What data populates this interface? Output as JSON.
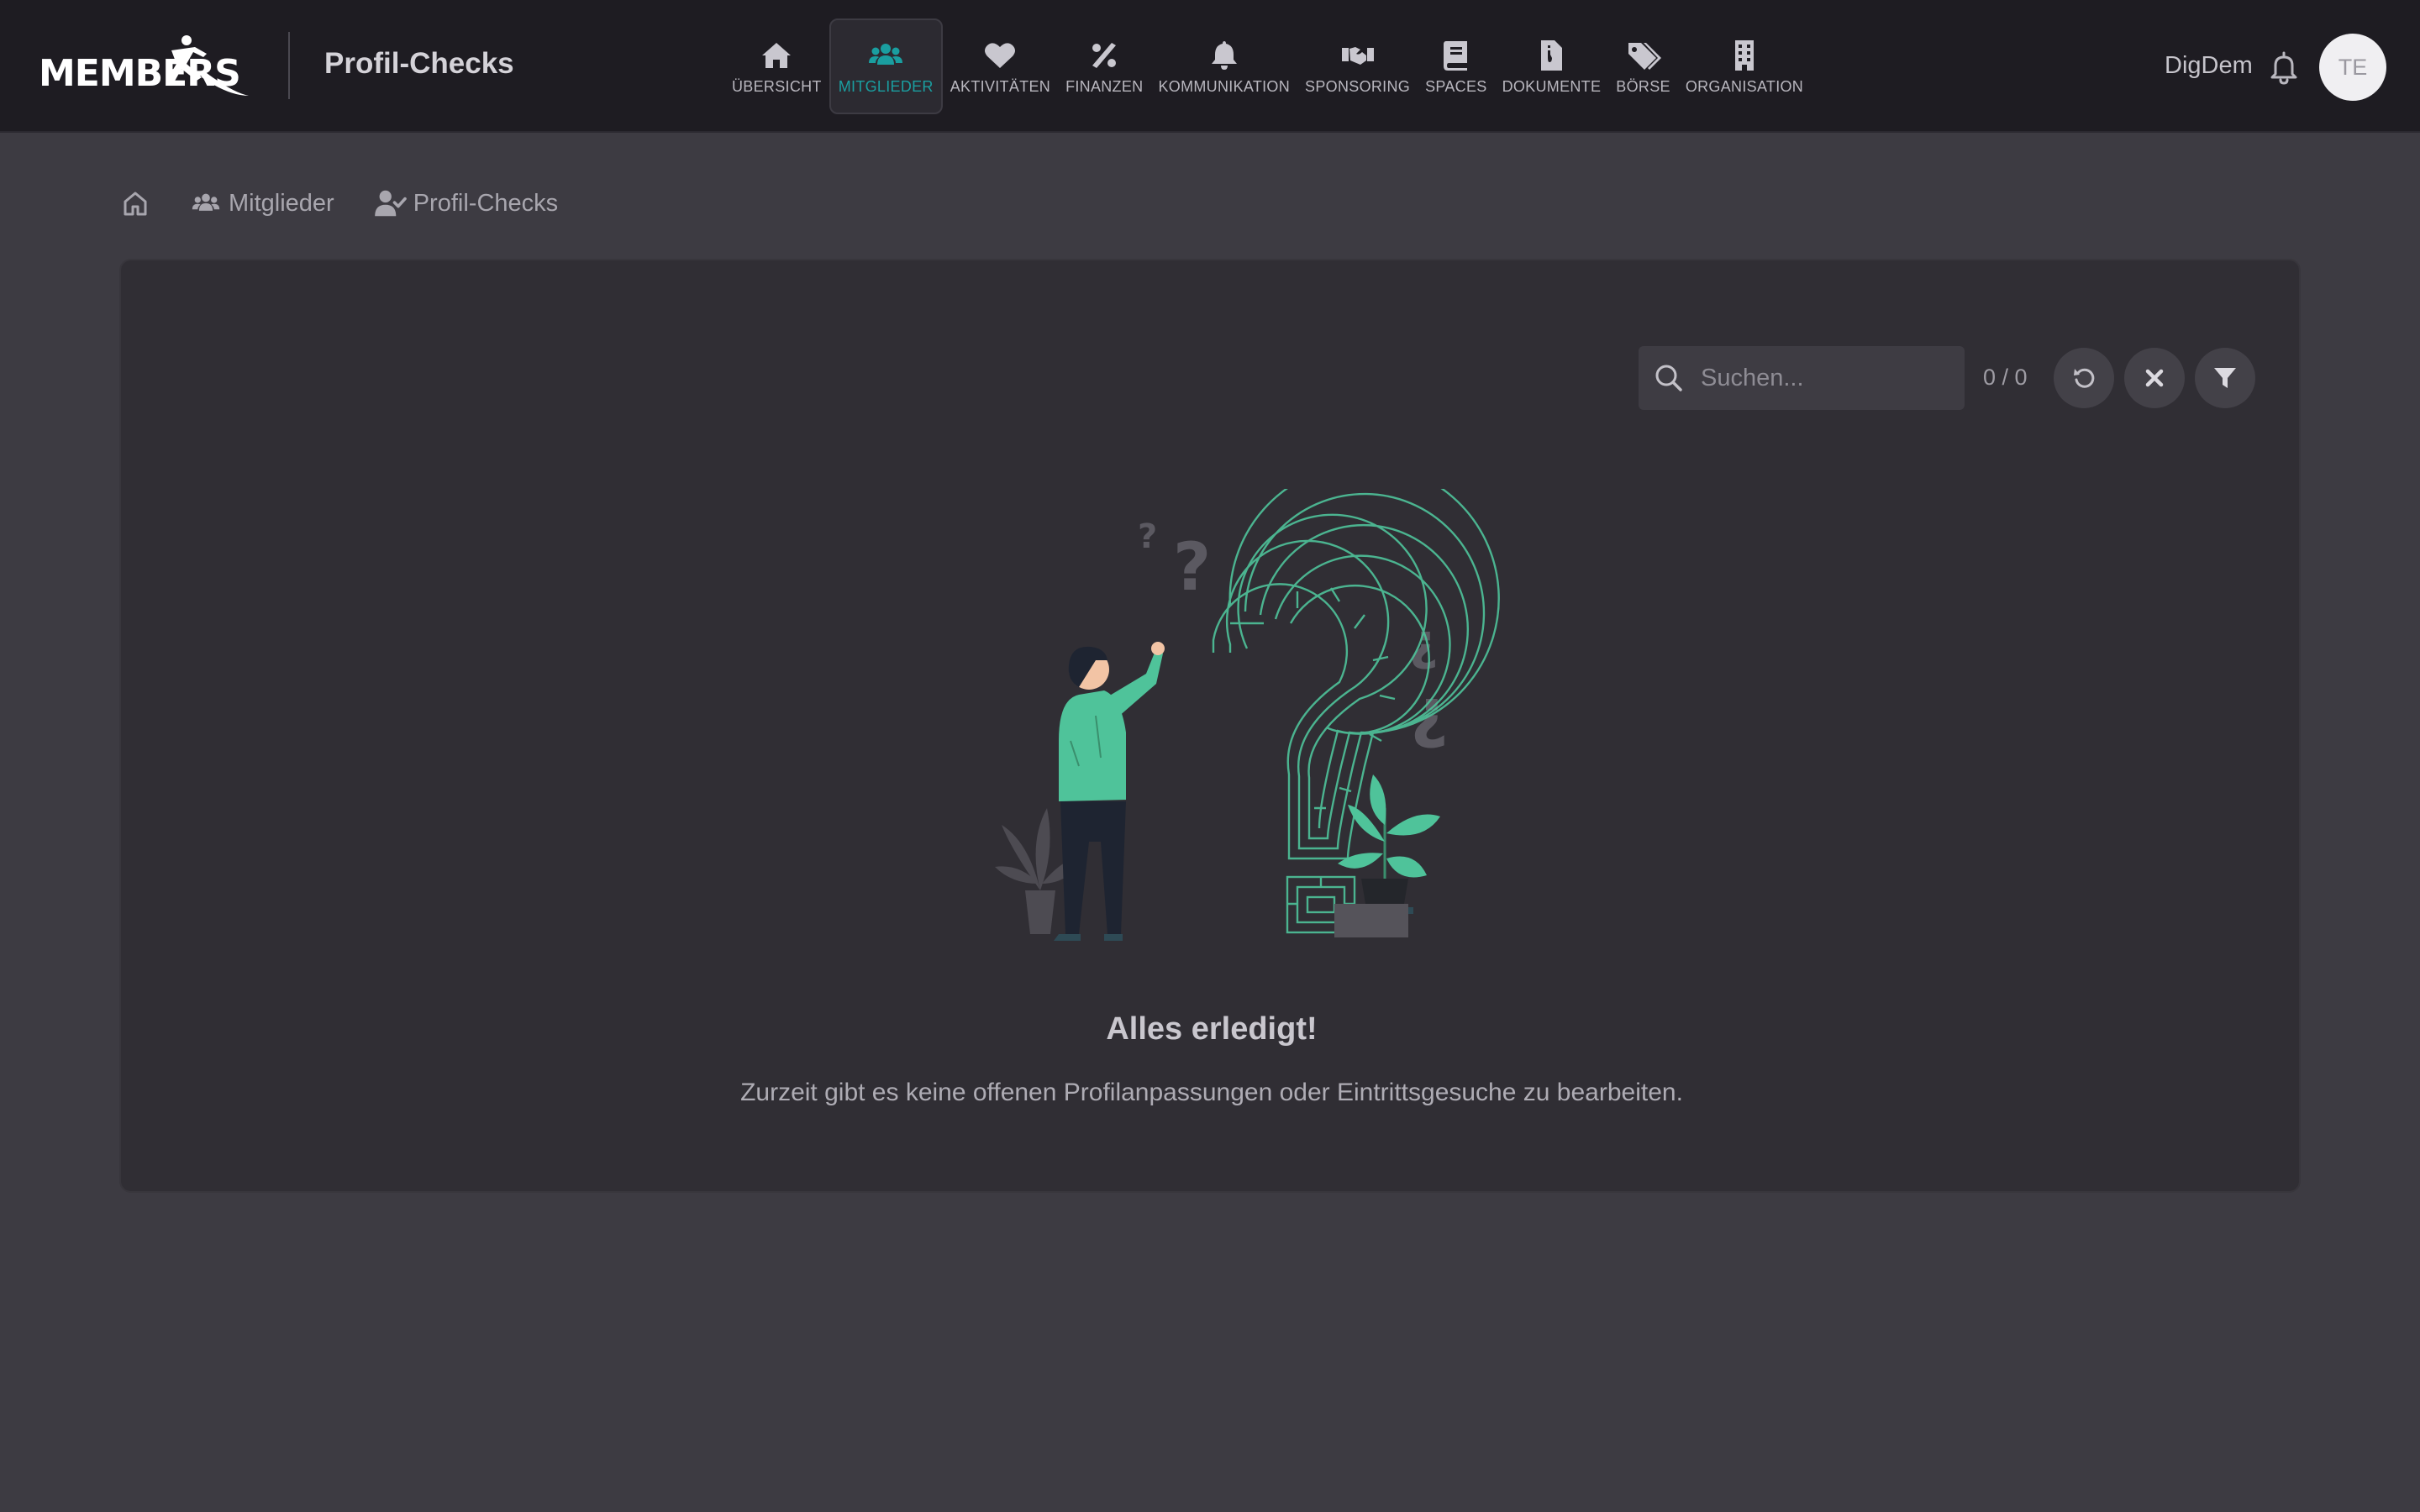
{
  "app": {
    "brand": "MEMBERS",
    "page_title": "Profil-Checks"
  },
  "nav": {
    "items": [
      {
        "label": "ÜBERSICHT",
        "icon": "home-icon"
      },
      {
        "label": "MITGLIEDER",
        "icon": "users-icon",
        "active": true
      },
      {
        "label": "AKTIVITÄTEN",
        "icon": "heart-pulse-icon"
      },
      {
        "label": "FINANZEN",
        "icon": "percent-icon"
      },
      {
        "label": "KOMMUNIKATION",
        "icon": "bell-icon"
      },
      {
        "label": "SPONSORING",
        "icon": "handshake-icon"
      },
      {
        "label": "SPACES",
        "icon": "book-icon"
      },
      {
        "label": "DOKUMENTE",
        "icon": "file-zipper-icon"
      },
      {
        "label": "BÖRSE",
        "icon": "tags-icon"
      },
      {
        "label": "ORGANISATION",
        "icon": "building-icon"
      }
    ],
    "active_color": "#1a9ea0"
  },
  "user": {
    "name": "DigDem",
    "initials": "TE"
  },
  "breadcrumb": {
    "items": [
      {
        "label": "",
        "icon": "home-icon"
      },
      {
        "label": "Mitglieder",
        "icon": "users-icon"
      },
      {
        "label": "Profil-Checks",
        "icon": "user-check-icon"
      }
    ]
  },
  "toolbar": {
    "search_placeholder": "Suchen...",
    "search_value": "",
    "counter": "0 / 0",
    "buttons": [
      "reset-icon",
      "close-icon",
      "filter-icon"
    ]
  },
  "empty_state": {
    "title": "Alles erledigt!",
    "message": "Zurzeit gibt es keine offenen Profilanpassungen oder Eintrittsgesuche zu bearbeiten."
  },
  "colors": {
    "topbar": "#1e1c22",
    "background": "#3d3b42",
    "card": "#302e34",
    "accent": "#1a9ea0",
    "illustration_green": "#4fc39a"
  }
}
